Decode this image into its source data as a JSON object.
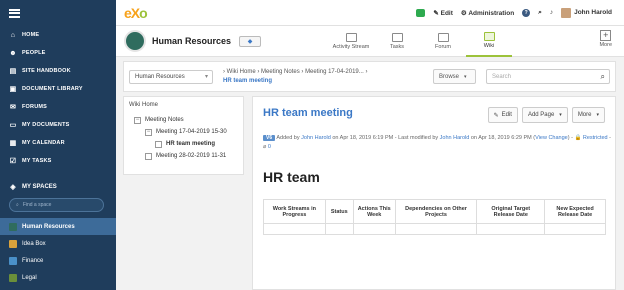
{
  "sidebar": {
    "nav": [
      {
        "icon": "home-icon",
        "glyph": "⌂",
        "label": "HOME"
      },
      {
        "icon": "people-icon",
        "glyph": "☻",
        "label": "PEOPLE"
      },
      {
        "icon": "handbook-icon",
        "glyph": "▤",
        "label": "SITE HANDBOOK"
      },
      {
        "icon": "document-library-icon",
        "glyph": "▣",
        "label": "DOCUMENT LIBRARY"
      },
      {
        "icon": "forums-icon",
        "glyph": "✉",
        "label": "FORUMS"
      },
      {
        "icon": "my-documents-icon",
        "glyph": "▭",
        "label": "MY DOCUMENTS"
      },
      {
        "icon": "calendar-icon",
        "glyph": "▦",
        "label": "MY CALENDAR"
      },
      {
        "icon": "tasks-icon",
        "glyph": "☑",
        "label": "MY TASKS"
      }
    ],
    "spaces_title": "MY SPACES",
    "find_placeholder": "Find a space",
    "spaces": [
      {
        "label": "Human Resources",
        "color": "#2f6c5e"
      },
      {
        "label": "Idea Box",
        "color": "#d9a23c"
      },
      {
        "label": "Finance",
        "color": "#4a90c8"
      },
      {
        "label": "Legal",
        "color": "#6a8f3a"
      }
    ]
  },
  "topbar": {
    "logo_e": "e",
    "logo_x": "X",
    "logo_o": "o",
    "edit_label": "Edit",
    "admin_label": "Administration",
    "user_name": "John Harold"
  },
  "space": {
    "title": "Human Resources",
    "tabs": [
      {
        "label": "Activity Stream"
      },
      {
        "label": "Tasks"
      },
      {
        "label": "Forum"
      },
      {
        "label": "Wiki"
      }
    ],
    "more_label": "More"
  },
  "toolbar": {
    "wiki_select": "Human Resources",
    "breadcrumb": {
      "wiki_home": "Wiki Home",
      "meeting_notes": "Meeting Notes",
      "meeting_date": "Meeting 17-04-2019...",
      "current": "HR team meeting"
    },
    "browse_label": "Browse",
    "search_placeholder": "Search"
  },
  "tree": {
    "home": "Wiki Home",
    "nodes": [
      {
        "label": "Meeting Notes",
        "toggle": "−"
      },
      {
        "label": "Meeting 17-04-2019 15-30",
        "toggle": "−"
      },
      {
        "label": "HR team meeting",
        "toggle": ""
      },
      {
        "label": "Meeting 28-02-2019 11-31",
        "toggle": ""
      }
    ]
  },
  "page": {
    "title": "HR team meeting",
    "edit_label": "Edit",
    "add_page_label": "Add Page",
    "more_label": "More",
    "meta": {
      "version": "V6",
      "added_by_text": "Added by",
      "added_by": "John Harold",
      "added_on": "on Apr 18, 2019 6:19 PM - Last modified by",
      "modified_by": "John Harold",
      "modified_on": "on Apr 18, 2019 6:29 PM (",
      "view_change": "View Change",
      "closing": ") -",
      "restricted": "Restricted",
      "separator": "-",
      "attachments": "0"
    },
    "heading": "HR team",
    "table": {
      "headers": [
        "Work Streams in Progress",
        "Status",
        "Actions This Week",
        "Dependencies on Other Projects",
        "Original Target Release Date",
        "New Expected Release Date"
      ]
    }
  }
}
